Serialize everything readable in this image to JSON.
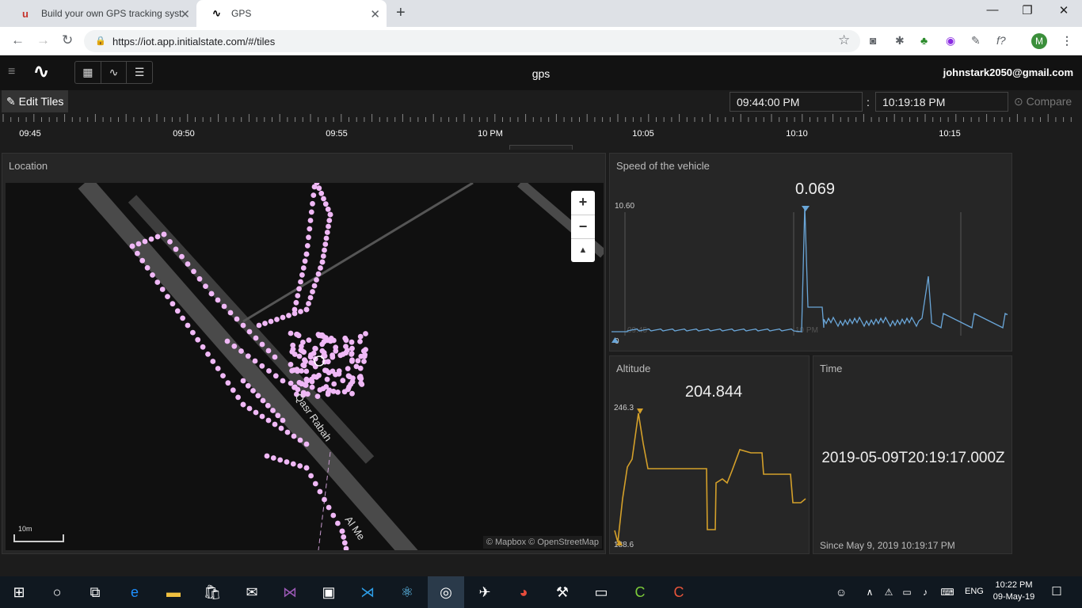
{
  "browser": {
    "tabs": [
      {
        "title": "Build your own GPS tracking syst",
        "favicon": "u"
      },
      {
        "title": "GPS",
        "favicon": "∿"
      }
    ],
    "url": "https://iot.app.initialstate.com/#/tiles",
    "avatar": "M"
  },
  "app": {
    "bucket_name": "gps",
    "user_email": "johnstark2050@gmail.com",
    "edit_tiles_label": "Edit Tiles",
    "start_time": "09:44:00 PM",
    "separator": ":",
    "end_time": "10:19:18 PM",
    "compare_label": "Compare",
    "timeline_labels": [
      "09:45",
      "09:50",
      "09:55",
      "10 PM",
      "10:05",
      "10:10",
      "10:15"
    ]
  },
  "tiles": {
    "location": {
      "title": "Location",
      "street_labels": [
        "Qasr Rabah",
        "Al Me"
      ],
      "scale_label": "10m",
      "attribution": "© Mapbox © OpenStreetMap",
      "zoom_in": "+",
      "zoom_out": "−",
      "reset_north": "▲"
    },
    "speed": {
      "title": "Speed of the vehicle",
      "current_value": "0.069",
      "max_label": "10.60",
      "min_label": "0",
      "time_marks": [
        "09:45",
        "10 PM"
      ]
    },
    "altitude": {
      "title": "Altitude",
      "current_value": "204.844",
      "max_label": "246.3",
      "min_label": "188.6"
    },
    "time": {
      "title": "Time",
      "value": "2019-05-09T20:19:17.000Z",
      "since": "Since May 9, 2019 10:19:17 PM"
    }
  },
  "taskbar": {
    "time": "10:22 PM",
    "date": "09-May-19",
    "lang": "ENG"
  },
  "colors": {
    "gps_track": "#f0b8f6",
    "speed_line": "#6aa6d8",
    "altitude_line": "#d4a02a",
    "accent_pink": "#c5312a"
  }
}
